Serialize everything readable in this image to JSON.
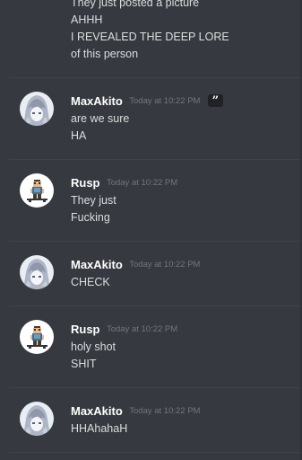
{
  "top_message": {
    "lines": [
      "They just posted a picture",
      "AHHH",
      "I REVEALED THE DEEP LORE",
      "of this person"
    ]
  },
  "messages": [
    {
      "username": "MaxAkito",
      "timestamp": "Today at 10:22 PM",
      "quote_icon": "”",
      "avatar_icon": "anime-avatar-icon",
      "lines": [
        "are we sure",
        "HA"
      ]
    },
    {
      "username": "Rusp",
      "timestamp": "Today at 10:22 PM",
      "avatar_icon": "pixel-character-avatar-icon",
      "lines": [
        "They just",
        "Fucking"
      ]
    },
    {
      "username": "MaxAkito",
      "timestamp": "Today at 10:22 PM",
      "avatar_icon": "anime-avatar-icon",
      "lines": [
        "CHECK"
      ]
    },
    {
      "username": "Rusp",
      "timestamp": "Today at 10:22 PM",
      "avatar_icon": "pixel-character-avatar-icon",
      "lines": [
        "holy shot",
        "SHIT"
      ]
    },
    {
      "username": "MaxAkito",
      "timestamp": "Today at 10:22 PM",
      "avatar_icon": "anime-avatar-icon",
      "lines": [
        "HHAhahaH"
      ]
    }
  ],
  "colors": {
    "background": "#36393f",
    "text": "#dcddde",
    "username": "#ffffff",
    "timestamp": "#72767d",
    "divider": "#40434a"
  }
}
